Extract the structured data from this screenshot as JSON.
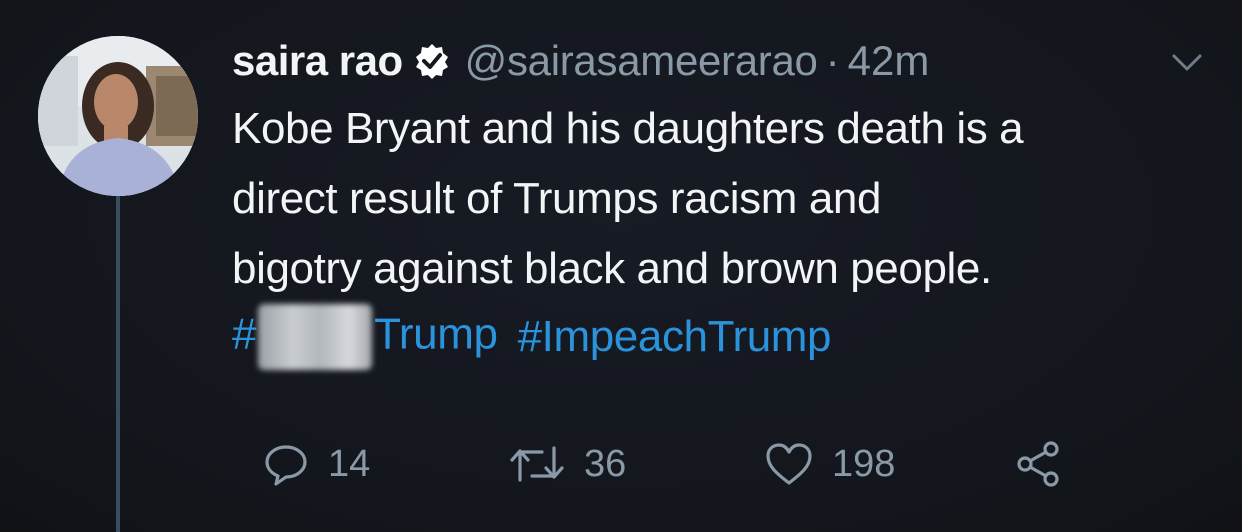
{
  "tweet": {
    "display_name": "saira rao",
    "handle": "@sairasameerarao",
    "separator": "·",
    "time": "42m",
    "text_lines": [
      "Kobe Bryant and his daughters death is a",
      "direct result of Trumps racism and",
      "bigotry against black and brown people."
    ],
    "hashtag1_prefix": "#",
    "hashtag1_suffix": "Trump",
    "hashtag2": "#ImpeachTrump"
  },
  "actions": {
    "reply_count": "14",
    "retweet_count": "36",
    "like_count": "198"
  },
  "icons": {
    "verified": "verified-badge-icon",
    "menu": "chevron-down-icon",
    "reply": "reply-icon",
    "retweet": "retweet-icon",
    "like": "heart-icon",
    "share": "share-icon"
  },
  "colors": {
    "background": "#15181f",
    "text": "#f2f4f6",
    "muted": "#8a99a6",
    "link": "#2a93dc",
    "thread_line": "#3a4d5c"
  }
}
